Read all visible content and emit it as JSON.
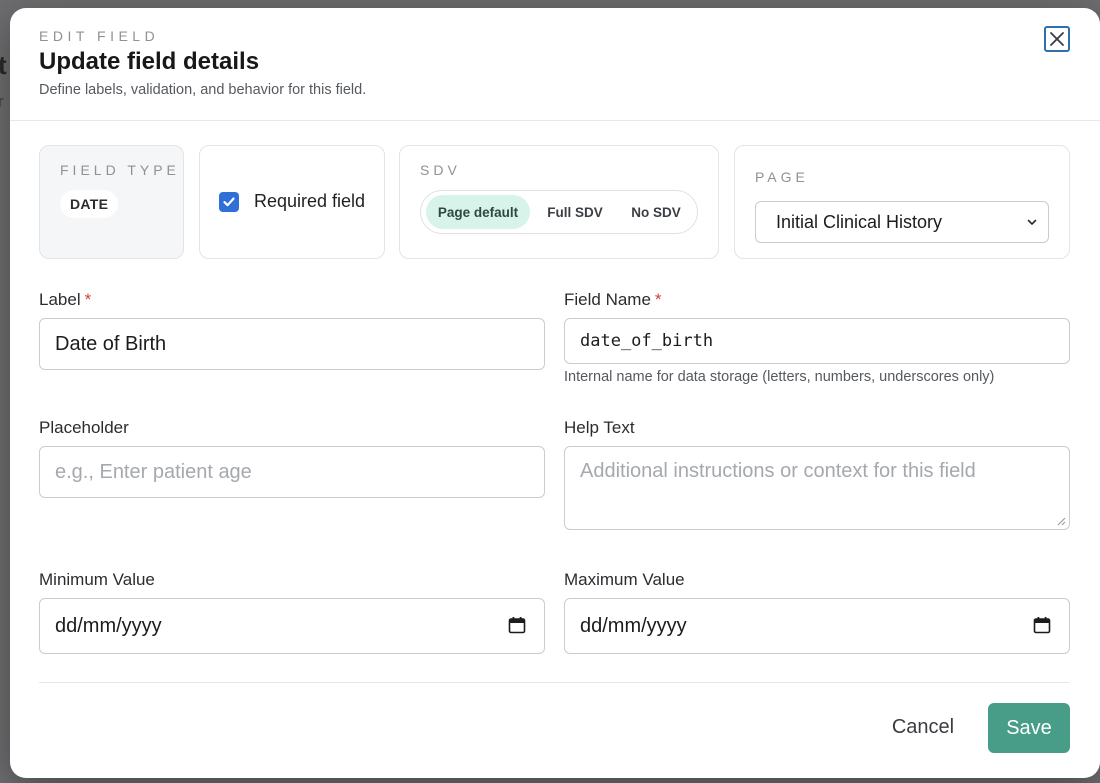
{
  "background": {
    "fragment_a": "t",
    "fragment_b": "r"
  },
  "header": {
    "eyebrow": "EDIT FIELD",
    "title": "Update field details",
    "subtitle": "Define labels, validation, and behavior for this field."
  },
  "field_type": {
    "label": "FIELD TYPE",
    "value": "DATE"
  },
  "required": {
    "label": "Required field",
    "checked": true
  },
  "sdv": {
    "label": "SDV",
    "options": [
      "Page default",
      "Full SDV",
      "No SDV"
    ],
    "selected": "Page default"
  },
  "page": {
    "label": "PAGE",
    "selected": "Initial Clinical History"
  },
  "form": {
    "label_field": {
      "label": "Label",
      "value": "Date of Birth",
      "required": "*"
    },
    "field_name": {
      "label": "Field Name",
      "value": "date_of_birth",
      "required": "*",
      "hint": "Internal name for data storage (letters, numbers, underscores only)"
    },
    "placeholder": {
      "label": "Placeholder",
      "placeholder": "e.g., Enter patient age"
    },
    "help_text": {
      "label": "Help Text",
      "placeholder": "Additional instructions or context for this field"
    },
    "min_value": {
      "label": "Minimum Value",
      "placeholder": "dd/mm/yyyy"
    },
    "max_value": {
      "label": "Maximum Value",
      "placeholder": "dd/mm/yyyy"
    }
  },
  "footer": {
    "cancel_label": "Cancel",
    "save_label": "Save"
  },
  "colors": {
    "accent": "#489d88",
    "checkbox": "#2f6fd6",
    "required_star": "#d4423a",
    "segment_active": "#d8f3ea"
  },
  "icons": {
    "close": "close-icon",
    "check": "check-icon",
    "chevron": "chevron-down-icon",
    "calendar": "calendar-icon"
  }
}
